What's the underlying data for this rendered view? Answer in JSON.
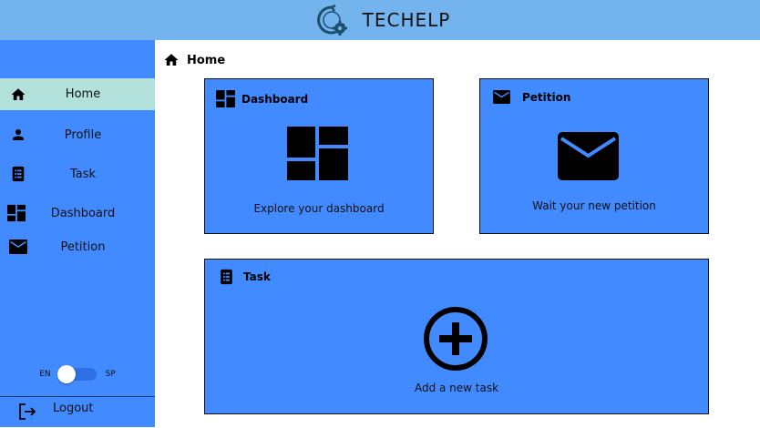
{
  "header": {
    "title": "TECHELP",
    "logo_icon": "gear-cycle-logo-icon"
  },
  "sidebar": {
    "items": [
      {
        "label": "Home",
        "icon": "home-icon",
        "active": true
      },
      {
        "label": "Profile",
        "icon": "person-icon",
        "active": false
      },
      {
        "label": "Task",
        "icon": "task-list-icon",
        "active": false
      },
      {
        "label": "Dashboard",
        "icon": "dashboard-icon",
        "active": false
      },
      {
        "label": "Petition",
        "icon": "mail-icon",
        "active": false
      }
    ],
    "language": {
      "left": "EN",
      "right": "SP",
      "selected": "EN"
    },
    "logout_label": "Logout"
  },
  "breadcrumb": {
    "label": "Home",
    "icon": "home-icon"
  },
  "cards": {
    "dashboard": {
      "title": "Dashboard",
      "text": "Explore your dashboard",
      "icon": "dashboard-icon"
    },
    "petition": {
      "title": "Petition",
      "text": "Wait your new petition",
      "icon": "mail-icon"
    },
    "task": {
      "title": "Task",
      "text": "Add a new task",
      "icon": "add-circle-icon"
    }
  },
  "colors": {
    "topbar": "#73b4ee",
    "sidebar": "#428aff",
    "active_item": "#b2e0da",
    "card": "#428aff",
    "switch_track": "#2e6fe6"
  }
}
